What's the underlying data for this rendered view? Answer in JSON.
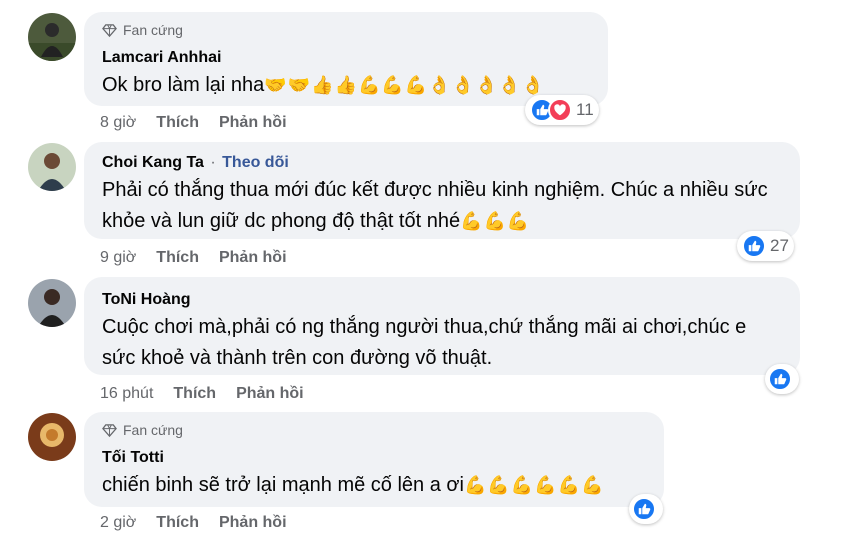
{
  "comments": [
    {
      "badge": "Fan cứng",
      "name": "Lamcari Anhhai",
      "follow": "",
      "text": "Ok bro làm lại nha",
      "emoji": "🤝🤝👍👍💪💪💪👌👌👌👌👌",
      "time": "8 giờ",
      "like_label": "Thích",
      "reply_label": "Phản hồi",
      "reaction_count": "11",
      "reactions": [
        "like-icon",
        "love-icon"
      ]
    },
    {
      "badge": "",
      "name": "Choi Kang Ta",
      "follow": "Theo dõi",
      "text": "Phải có thắng thua mới đúc kết được nhiều kinh nghiệm. Chúc a nhiều sức khỏe và lun giữ dc phong độ thật tốt nhé",
      "emoji": "💪💪💪",
      "time": "9 giờ",
      "like_label": "Thích",
      "reply_label": "Phản hồi",
      "reaction_count": "27",
      "reactions": [
        "like-icon"
      ]
    },
    {
      "badge": "",
      "name": "ToNi Hoàng",
      "follow": "",
      "text": "Cuộc chơi mà,phải có ng thắng người thua,chứ thắng mãi ai chơi,chúc e sức khoẻ và thành trên con đường võ thuật.",
      "emoji": "",
      "time": "16 phút",
      "like_label": "Thích",
      "reply_label": "Phản hồi",
      "reaction_count": "",
      "reactions": [
        "like-icon"
      ]
    },
    {
      "badge": "Fan cứng",
      "name": "Tối Totti",
      "follow": "",
      "text": "chiến binh sẽ trở lại mạnh mẽ cố lên a ơi",
      "emoji": "💪💪💪💪💪💪",
      "time": "2 giờ",
      "like_label": "Thích",
      "reply_label": "Phản hồi",
      "reaction_count": "",
      "reactions": [
        "like-icon"
      ]
    }
  ],
  "colors": {
    "bubble": "#f0f2f5",
    "like_blue": "#1877f2",
    "love_red": "#f33e58",
    "follow_blue": "#385898",
    "meta_gray": "#65676b"
  }
}
